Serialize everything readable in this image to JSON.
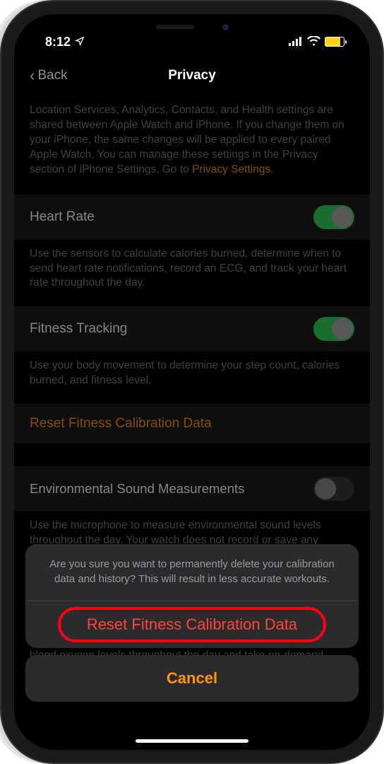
{
  "statusBar": {
    "time": "8:12"
  },
  "nav": {
    "back": "Back",
    "title": "Privacy"
  },
  "intro": {
    "text": "Location Services, Analytics, Contacts, and Health settings are shared between Apple Watch and iPhone. If you change them on your iPhone, the same changes will be applied to every paired Apple Watch. You can manage these settings in the Privacy section of iPhone Settings. Go to ",
    "linkText": "Privacy Settings"
  },
  "sections": {
    "heartRate": {
      "label": "Heart Rate",
      "enabled": true,
      "desc": "Use the sensors to calculate calories burned, determine when to send heart rate notifications, record an ECG, and track your heart rate throughout the day."
    },
    "fitness": {
      "label": "Fitness Tracking",
      "enabled": true,
      "desc": "Use your body movement to determine your step count, calories burned, and fitness level."
    },
    "resetCalib": {
      "label": "Reset Fitness Calibration Data"
    },
    "envSound": {
      "label": "Environmental Sound Measurements",
      "enabled": false,
      "desc": "Use the microphone to measure environmental sound levels throughout the day. Your watch does not record or save any sounds to measure these levels."
    },
    "partialBehindSheet": "blood oxygen levels throughout the day and take on-demand"
  },
  "actionSheet": {
    "message": "Are you sure you want to permanently delete your calibration data and history? This will result in less accurate workouts.",
    "destructive": "Reset Fitness Calibration Data",
    "cancel": "Cancel"
  }
}
